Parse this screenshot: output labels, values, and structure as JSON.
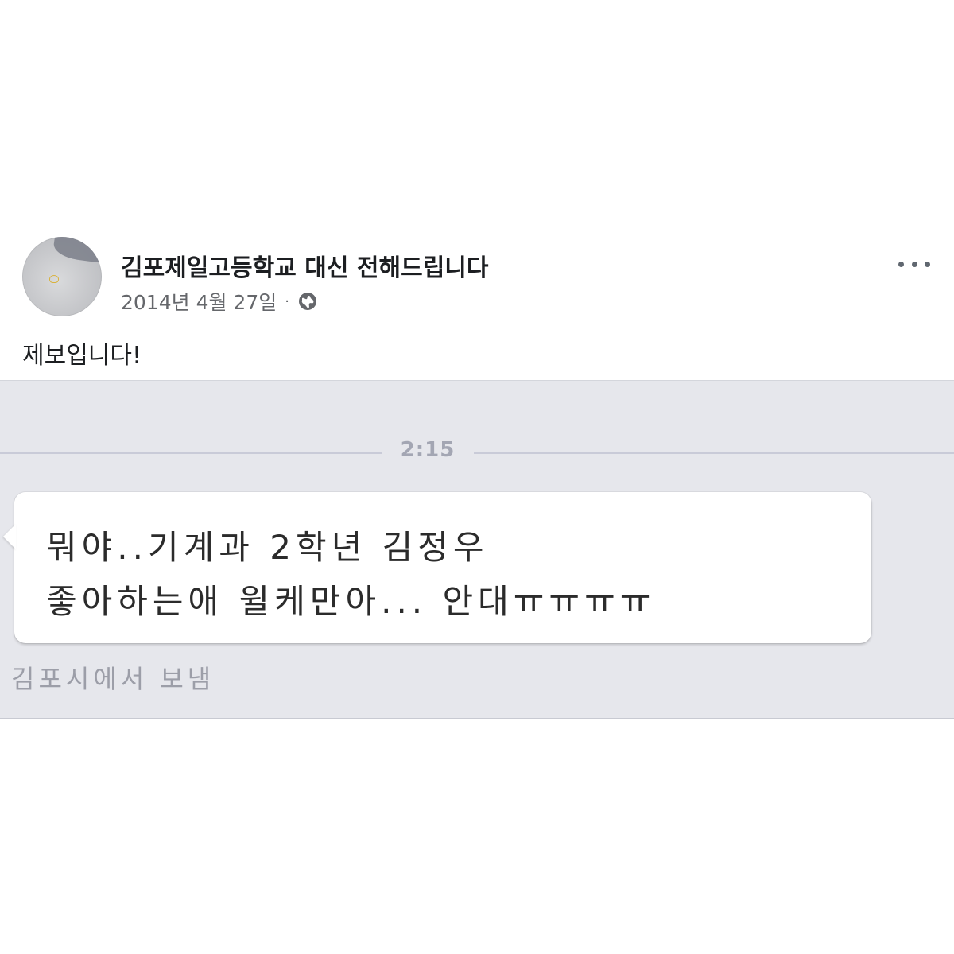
{
  "post": {
    "page_name": "김포제일고등학교 대신 전해드립니다",
    "date": "2014년 4월 27일",
    "separator": "·",
    "privacy_icon": "globe-icon",
    "more_icon": "more-options-icon",
    "caption": "제보입니다!"
  },
  "attachment": {
    "time": "2:15",
    "message_lines": [
      "뭐야..기계과 2학년 김정우",
      "좋아하는애 윌케만아... 안대ㅠㅠㅠㅠ"
    ],
    "sent_from": "김포시에서 보냄"
  },
  "colors": {
    "text_primary": "#1c1e21",
    "text_secondary": "#65676b",
    "attachment_bg": "#e6e7ec",
    "bubble_bg": "#ffffff",
    "timestamp": "#a3a6b3"
  }
}
